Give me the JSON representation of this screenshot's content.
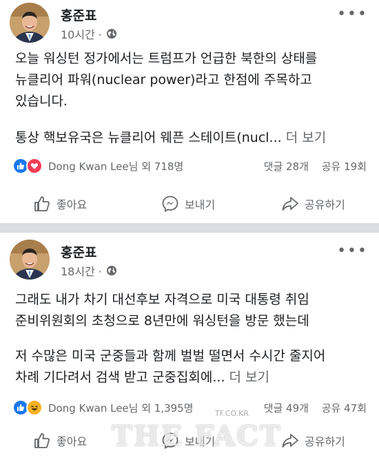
{
  "posts": [
    {
      "author": "홍준표",
      "time": "10시간 ·",
      "lines": [
        "오늘 워싱턴 정가에서는 트럼프가 언급한 북한의 상태를",
        "뉴클리어 파워(nuclear power)라고 한점에 주목하고",
        "있습니다."
      ],
      "last_line": "통상 핵보유국은 뉴클리어 웨픈 스테이트(nucl...",
      "see_more": "더 보기",
      "reactors": "Dong Kwan Lee님 외 718명",
      "comments": "댓글 28개",
      "shares": "공유 19회"
    },
    {
      "author": "홍준표",
      "time": "18시간 ·",
      "lines": [
        "그래도 내가 차기 대선후보 자격으로 미국 대통령 취임",
        "준비위원회의 초청으로 8년만에 워싱턴을  방문 했는데"
      ],
      "lines2": [
        "저 수많은 미국 군중들과 함께 벌벌 떨면서 수시간 줄지어"
      ],
      "last_line": "차례 기다려서 검색 받고 군중집회에...",
      "see_more": "더 보기",
      "reactors": "Dong Kwan Lee님 외 1,395명",
      "comments": "댓글 49개",
      "shares": "공유 47회"
    }
  ],
  "actions": {
    "like": "좋아요",
    "send": "보내기",
    "share": "공유하기"
  },
  "watermark": {
    "text": "THE FACT",
    "small": "TF.CO.KR"
  },
  "colors": {
    "like_blue": "#1877f2",
    "love_red": "#f33e58",
    "haha_yellow": "#f7b125",
    "meta_gray": "#65676b",
    "divider": "#dadde1"
  }
}
